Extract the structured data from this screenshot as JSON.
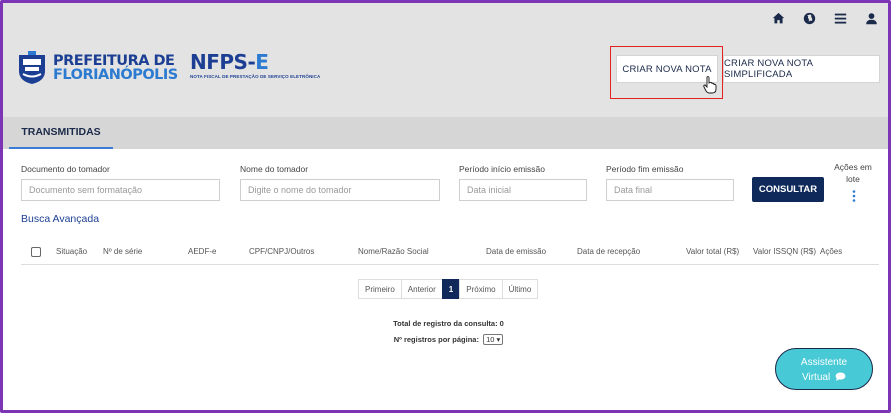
{
  "header": {
    "brand_line1": "PREFEITURA DE",
    "brand_line2": "FLORIANÓPOLIS",
    "product_main": "NFPS-",
    "product_suffix": "E",
    "product_subtitle": "NOTA FISCAL DE PRESTAÇÃO DE SERVIÇO ELETRÔNICA",
    "icons": [
      "home-icon",
      "globe-icon",
      "menu-icon",
      "user-icon"
    ],
    "btn_criar": "CRIAR NOVA NOTA",
    "btn_simplificada": "CRIAR NOVA NOTA SIMPLIFICADA"
  },
  "tabs": {
    "active": "TRANSMITIDAS"
  },
  "filters": {
    "documento_label": "Documento do tomador",
    "documento_placeholder": "Documento sem formatação",
    "nome_label": "Nome do tomador",
    "nome_placeholder": "Digite o nome do tomador",
    "inicio_label": "Período início emissão",
    "inicio_placeholder": "Data inicial",
    "fim_label": "Período fim emissão",
    "fim_placeholder": "Data final",
    "consultar": "CONSULTAR",
    "acoes_lote": "Ações em lote",
    "busca_avancada": "Busca Avançada"
  },
  "table": {
    "columns": [
      "Situação",
      "Nº de série",
      "AEDF-e",
      "CPF/CNPJ/Outros",
      "Nome/Razão Social",
      "Data de emissão",
      "Data de recepção",
      "Valor total (R$)",
      "Valor ISSQN (R$)",
      "Ações"
    ]
  },
  "pagination": {
    "first": "Primeiro",
    "prev": "Anterior",
    "current": "1",
    "next": "Próximo",
    "last": "Último"
  },
  "footer": {
    "total_label": "Total de registro da consulta: 0",
    "per_page_label": "Nº registros por página:",
    "per_page_value": "10"
  },
  "assistant": {
    "line1": "Assistente",
    "line2": "Virtual"
  },
  "colors": {
    "brand_dark": "#0f2a5a",
    "brand_blue": "#1c3f94",
    "highlight": "#e32121",
    "assistant": "#47c9d6",
    "frame": "#7b35b5"
  }
}
